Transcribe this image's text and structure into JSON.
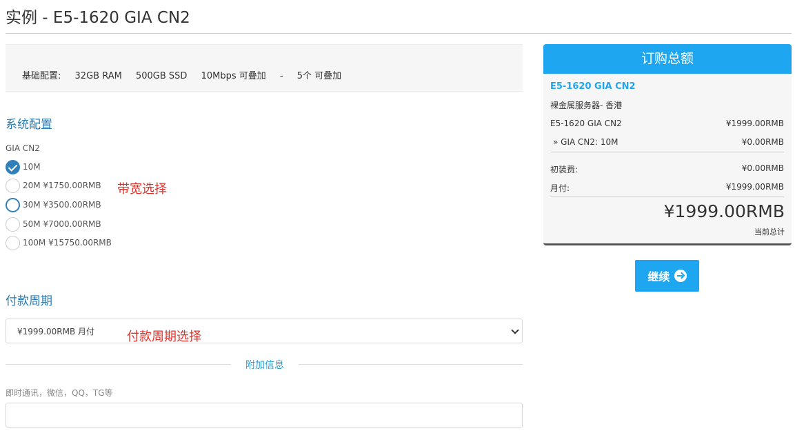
{
  "page": {
    "title": "实例 - E5-1620 GIA CN2"
  },
  "base_config": {
    "label": "基础配置:",
    "ram": "32GB RAM",
    "disk": "500GB SSD",
    "bandwidth": "10Mbps 可叠加",
    "sep": "-",
    "ip": "5个 可叠加"
  },
  "system_config": {
    "title": "系统配置",
    "option_label": "GIA CN2",
    "options": [
      {
        "label": "10M",
        "checked": true
      },
      {
        "label": "20M ¥1750.00RMB",
        "checked": false
      },
      {
        "label": "30M ¥3500.00RMB",
        "checked": false
      },
      {
        "label": "50M ¥7000.00RMB",
        "checked": false
      },
      {
        "label": "100M ¥15750.00RMB",
        "checked": false
      }
    ],
    "annotation": "带宽选择"
  },
  "billing": {
    "title": "付款周期",
    "selected": "¥1999.00RMB 月付",
    "annotation": "付款周期选择"
  },
  "additional": {
    "divider_label": "附加信息",
    "field_label": "即时通讯，微信，QQ，TG等",
    "field_value": ""
  },
  "summary": {
    "header": "订购总额",
    "product_name": "E5-1620 GIA CN2",
    "product_group": "裸金属服务器- 香港",
    "lines": [
      {
        "label": "E5-1620 GIA CN2",
        "value": "¥1999.00RMB"
      },
      {
        "label": "» GIA CN2: 10M",
        "value": "¥0.00RMB"
      }
    ],
    "setup_label": "初装费:",
    "setup_value": "¥0.00RMB",
    "monthly_label": "月付:",
    "monthly_value": "¥1999.00RMB",
    "total": "¥1999.00RMB",
    "total_label": "当前总计"
  },
  "actions": {
    "continue_label": "继续"
  },
  "colors": {
    "accent": "#1ea6f1",
    "section_title": "#2a7ab0",
    "annotation": "#e0302a"
  }
}
